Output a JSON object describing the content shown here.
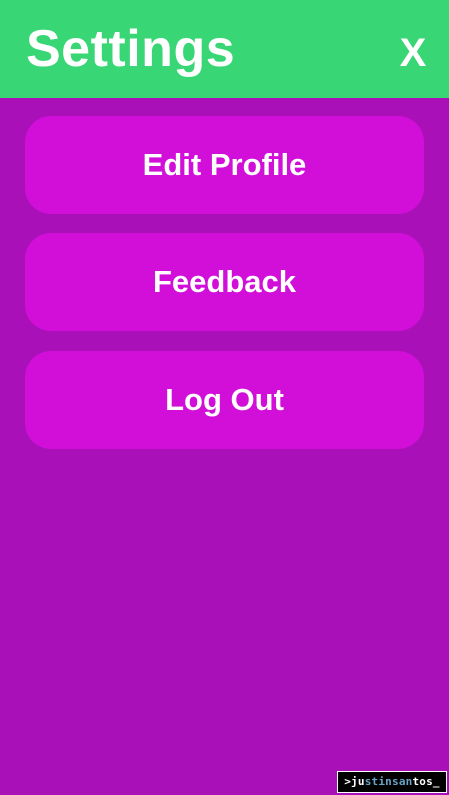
{
  "header": {
    "title": "Settings",
    "close_label": "X"
  },
  "menu": {
    "items": [
      {
        "label": "Edit Profile"
      },
      {
        "label": "Feedback"
      },
      {
        "label": "Log Out"
      }
    ]
  },
  "watermark": {
    "prompt": ">",
    "part1": "ju",
    "part2": "stinsan",
    "part3": "tos_"
  },
  "colors": {
    "header_bg": "#38d674",
    "page_bg": "#aa10b8",
    "button_bg": "#d10fd9",
    "text": "#ffffff"
  }
}
